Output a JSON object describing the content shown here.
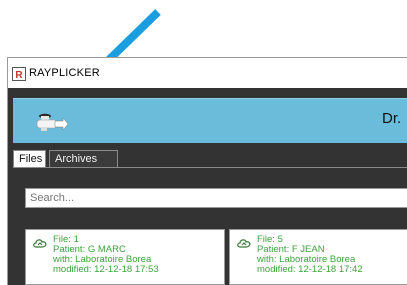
{
  "window": {
    "title": "RAYPLICKER"
  },
  "header": {
    "text": "Dr."
  },
  "tabs": [
    {
      "label": "Files",
      "active": true
    },
    {
      "label": "Archives",
      "active": false
    }
  ],
  "search": {
    "placeholder": "Search..."
  },
  "cards": [
    {
      "file": "File: 1",
      "patient": "Patient: G MARC",
      "with": "with:  Laboratoire Borea",
      "modified": "modified: 12-12-18 17:53"
    },
    {
      "file": "File: 5",
      "patient": "Patient: F JEAN",
      "with": "with:  Laboratoire Borea",
      "modified": "modified: 12-12-18 17:42"
    }
  ],
  "colors": {
    "header_bg": "#6bbcdb",
    "frame_bg": "#333333",
    "card_text": "#3aa53a",
    "arrow": "#1a9ee0"
  }
}
